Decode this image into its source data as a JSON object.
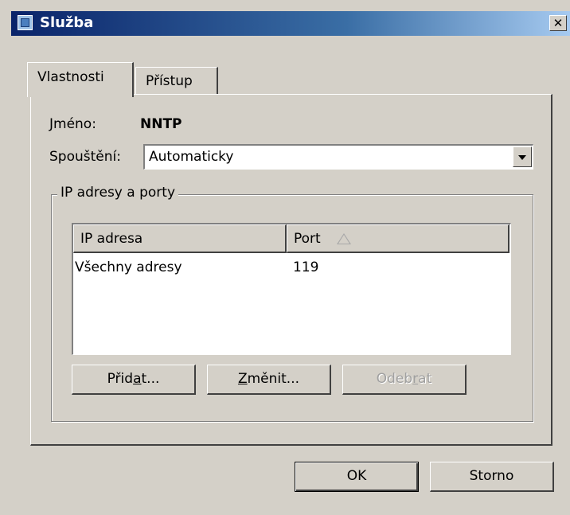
{
  "window": {
    "title": "Služba"
  },
  "tabs": [
    {
      "label": "Vlastnosti",
      "active": true
    },
    {
      "label": "Přístup",
      "active": false
    }
  ],
  "fields": {
    "name_label": "Jméno:",
    "name_value": "NNTP",
    "startup_label": "Spouštění:",
    "startup_value": "Automaticky"
  },
  "group": {
    "legend": "IP adresy a porty",
    "columns": [
      "IP adresa",
      "Port"
    ],
    "sort_column": "Port",
    "rows": [
      {
        "ip": "Všechny adresy",
        "port": "119"
      }
    ]
  },
  "buttons": {
    "add": {
      "pre": "Přid",
      "accel": "a",
      "post": "t..."
    },
    "edit": {
      "pre": "",
      "accel": "Z",
      "post": "měnit..."
    },
    "remove": {
      "pre": "Odeb",
      "accel": "r",
      "post": "at"
    },
    "ok": "OK",
    "cancel": "Storno"
  },
  "icons": {
    "app": "service-window-icon",
    "close": "close-icon",
    "dropdown": "chevron-down-icon",
    "sort": "sort-ascending-icon"
  }
}
